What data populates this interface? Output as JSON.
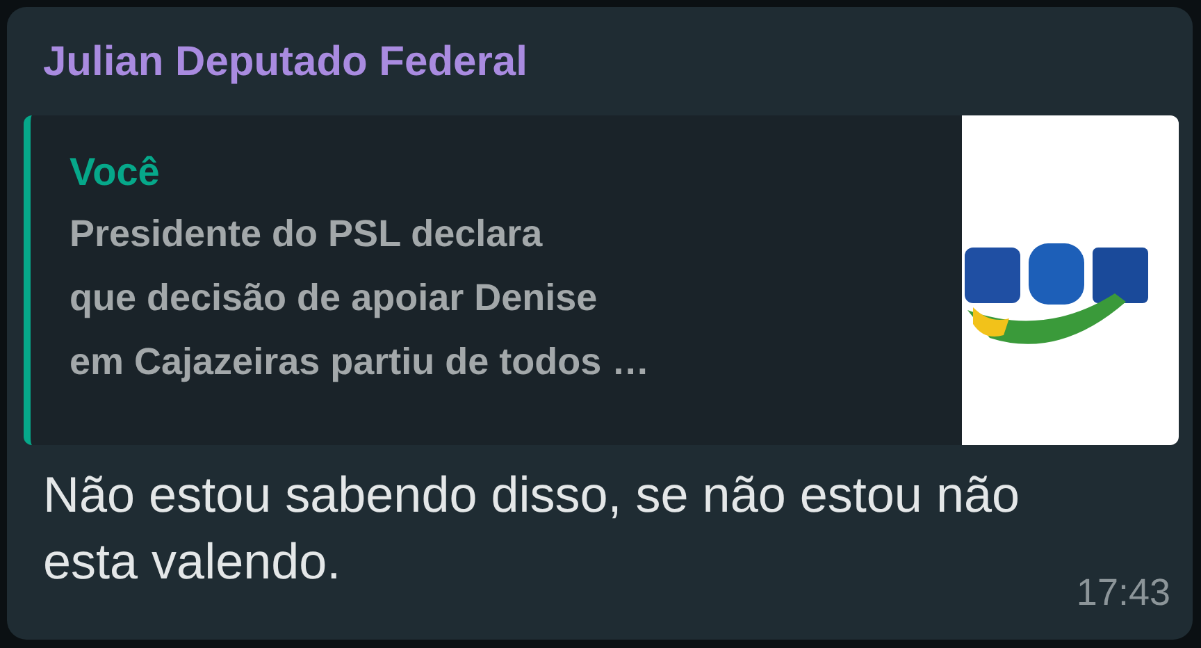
{
  "message": {
    "sender": "Julian Deputado Federal",
    "quote": {
      "author": "Você",
      "lines": [
        "Presidente do PSL declara",
        "que decisão de apoiar Denise",
        "em Cajazeiras partiu de todos …"
      ]
    },
    "text": "Não estou sabendo disso, se não estou não esta valendo.",
    "time": "17:43"
  }
}
